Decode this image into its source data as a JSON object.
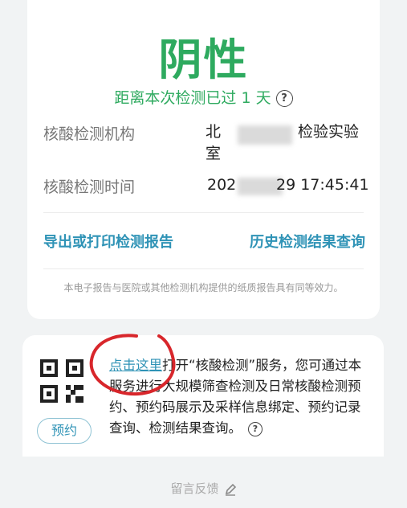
{
  "result": {
    "status": "阴性",
    "elapsed_text": "距离本次检测已过 1 天"
  },
  "info": {
    "institution_label": "核酸检测机构",
    "institution_value_start": "北",
    "institution_value_end": "检验实验",
    "institution_value_line2": "室",
    "time_label": "核酸检测时间",
    "time_value_start": "202",
    "time_value_end": "29 17:45:41"
  },
  "links": {
    "export": "导出或打印检测报告",
    "history": "历史检测结果查询"
  },
  "disclaimer": "本电子报告与医院或其他检测机构提供的纸质报告具有同等效力。",
  "service": {
    "book_label": "预约",
    "link_text": "点击这里",
    "description": "打开“核酸检测”服务，您可通过本服务进行大规模筛查检测及日常核酸检测预约、预约码展示及采样信息绑定、预约记录查询、检测结果查询。"
  },
  "feedback": "留言反馈",
  "colors": {
    "positive_green": "#2eaa5f",
    "link_blue": "#2f93b6",
    "annotation_red": "#d8262b"
  },
  "icons": [
    "help-icon",
    "qr-code-icon",
    "pencil-icon"
  ]
}
